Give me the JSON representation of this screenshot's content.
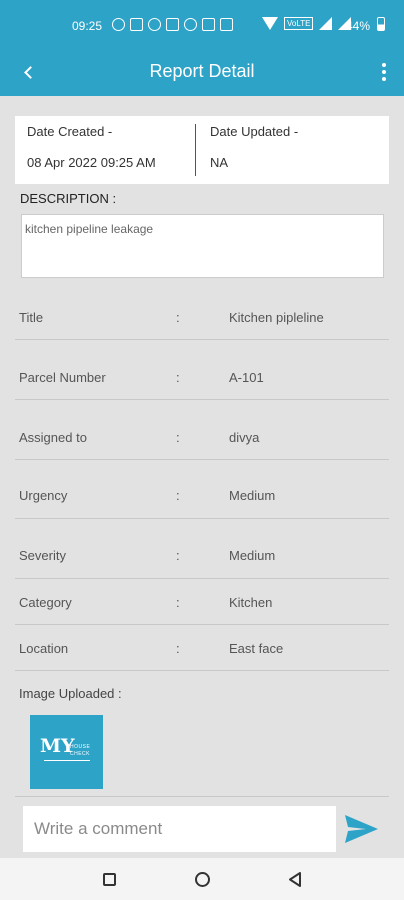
{
  "status_bar": {
    "time": "09:25",
    "battery": "44%",
    "network_badge": "VoLTE",
    "battery_level": 0.44
  },
  "header": {
    "title": "Report Detail"
  },
  "dates": {
    "created_label": "Date Created -",
    "created_value": "08 Apr 2022 09:25 AM",
    "updated_label": "Date Updated -",
    "updated_value": "NA"
  },
  "description": {
    "label": "DESCRIPTION :",
    "text": "kitchen pipeline leakage"
  },
  "details": [
    {
      "label": "Title",
      "sep": ":",
      "value": "Kitchen pipleline"
    },
    {
      "label": "Parcel Number",
      "sep": ":",
      "value": "A-101"
    },
    {
      "label": "Assigned to",
      "sep": ":",
      "value": "divya"
    },
    {
      "label": "Urgency",
      "sep": ":",
      "value": "Medium"
    },
    {
      "label": "Severity",
      "sep": ":",
      "value": "Medium"
    },
    {
      "label": "Category",
      "sep": ":",
      "value": "Kitchen"
    },
    {
      "label": "Location",
      "sep": ":",
      "value": "East face"
    }
  ],
  "image_section": {
    "label": "Image Uploaded :",
    "logo_letters": "MY",
    "logo_text_line1": "HOUSE",
    "logo_text_line2": "CHECK"
  },
  "comment": {
    "placeholder": "Write a comment"
  },
  "colors": {
    "primary": "#2ea3c8",
    "background": "#e2e2e2"
  }
}
